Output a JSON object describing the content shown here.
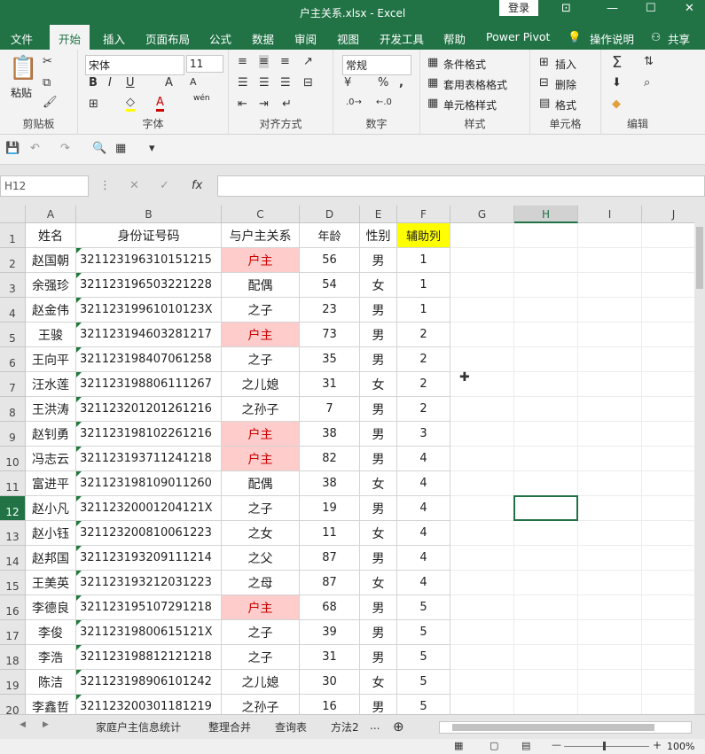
{
  "window": {
    "title": "户主关系.xlsx  -  Excel",
    "login": "登录"
  },
  "menu": {
    "file": "文件",
    "home": "开始",
    "insert": "插入",
    "layout": "页面布局",
    "formula": "公式",
    "data": "数据",
    "review": "审阅",
    "view": "视图",
    "dev": "开发工具",
    "help": "帮助",
    "pp": "Power Pivot",
    "tell": "操作说明",
    "share": "共享"
  },
  "ribbon": {
    "paste": "粘贴",
    "clipboard": "剪贴板",
    "font_name": "宋体",
    "font_size": "11",
    "font": "字体",
    "align": "对齐方式",
    "numfmt": "常规",
    "number": "数字",
    "cond": "条件格式",
    "table": "套用表格格式",
    "cellstyle": "单元格样式",
    "styles": "样式",
    "ins": "插入",
    "del": "删除",
    "fmt": "格式",
    "cells": "单元格",
    "edit": "编辑",
    "wen": "wén"
  },
  "formula": {
    "namebox": "H12",
    "fx": "fx",
    "value": ""
  },
  "columns": [
    "A",
    "B",
    "C",
    "D",
    "E",
    "F",
    "G",
    "H",
    "I",
    "J"
  ],
  "headers": [
    "姓名",
    "身份证号码",
    "与户主关系",
    "年龄",
    "性别",
    "辅助列"
  ],
  "rows": [
    {
      "n": "1",
      "name": "",
      "id": "",
      "rel": "",
      "age": "",
      "sex": "",
      "aux": ""
    },
    {
      "n": "2",
      "name": "赵国朝",
      "id": "321123196310151215",
      "rel": "户主",
      "age": "56",
      "sex": "男",
      "aux": "1"
    },
    {
      "n": "3",
      "name": "余强珍",
      "id": "321123196503221228",
      "rel": "配偶",
      "age": "54",
      "sex": "女",
      "aux": "1"
    },
    {
      "n": "4",
      "name": "赵金伟",
      "id": "32112319961010123X",
      "rel": "之子",
      "age": "23",
      "sex": "男",
      "aux": "1"
    },
    {
      "n": "5",
      "name": "王骏",
      "id": "321123194603281217",
      "rel": "户主",
      "age": "73",
      "sex": "男",
      "aux": "2"
    },
    {
      "n": "6",
      "name": "王向平",
      "id": "321123198407061258",
      "rel": "之子",
      "age": "35",
      "sex": "男",
      "aux": "2"
    },
    {
      "n": "7",
      "name": "汪水莲",
      "id": "321123198806111267",
      "rel": "之儿媳",
      "age": "31",
      "sex": "女",
      "aux": "2"
    },
    {
      "n": "8",
      "name": "王洪涛",
      "id": "321123201201261216",
      "rel": "之孙子",
      "age": "7",
      "sex": "男",
      "aux": "2"
    },
    {
      "n": "9",
      "name": "赵钊勇",
      "id": "321123198102261216",
      "rel": "户主",
      "age": "38",
      "sex": "男",
      "aux": "3"
    },
    {
      "n": "10",
      "name": "冯志云",
      "id": "321123193711241218",
      "rel": "户主",
      "age": "82",
      "sex": "男",
      "aux": "4"
    },
    {
      "n": "11",
      "name": "富进平",
      "id": "321123198109011260",
      "rel": "配偶",
      "age": "38",
      "sex": "女",
      "aux": "4"
    },
    {
      "n": "12",
      "name": "赵小凡",
      "id": "32112320001204121X",
      "rel": "之子",
      "age": "19",
      "sex": "男",
      "aux": "4"
    },
    {
      "n": "13",
      "name": "赵小钰",
      "id": "321123200810061223",
      "rel": "之女",
      "age": "11",
      "sex": "女",
      "aux": "4"
    },
    {
      "n": "14",
      "name": "赵邦国",
      "id": "321123193209111214",
      "rel": "之父",
      "age": "87",
      "sex": "男",
      "aux": "4"
    },
    {
      "n": "15",
      "name": "王美英",
      "id": "321123193212031223",
      "rel": "之母",
      "age": "87",
      "sex": "女",
      "aux": "4"
    },
    {
      "n": "16",
      "name": "李德良",
      "id": "321123195107291218",
      "rel": "户主",
      "age": "68",
      "sex": "男",
      "aux": "5"
    },
    {
      "n": "17",
      "name": "李俊",
      "id": "32112319800615121X",
      "rel": "之子",
      "age": "39",
      "sex": "男",
      "aux": "5"
    },
    {
      "n": "18",
      "name": "李浩",
      "id": "321123198812121218",
      "rel": "之子",
      "age": "31",
      "sex": "男",
      "aux": "5"
    },
    {
      "n": "19",
      "name": "陈洁",
      "id": "321123198906101242",
      "rel": "之儿媳",
      "age": "30",
      "sex": "女",
      "aux": "5"
    },
    {
      "n": "20",
      "name": "李鑫哲",
      "id": "321123200301181219",
      "rel": "之孙子",
      "age": "16",
      "sex": "男",
      "aux": "5"
    }
  ],
  "sheets": [
    "家庭户主信息统计",
    "整理合并",
    "查询表",
    "方法2",
    "..."
  ],
  "status": {
    "zoom": "100%"
  },
  "colors": {
    "accent": "#217346",
    "highlight_fill": "#ffcccc",
    "highlight_text": "#cc0000",
    "header_yellow": "#ffff00"
  }
}
